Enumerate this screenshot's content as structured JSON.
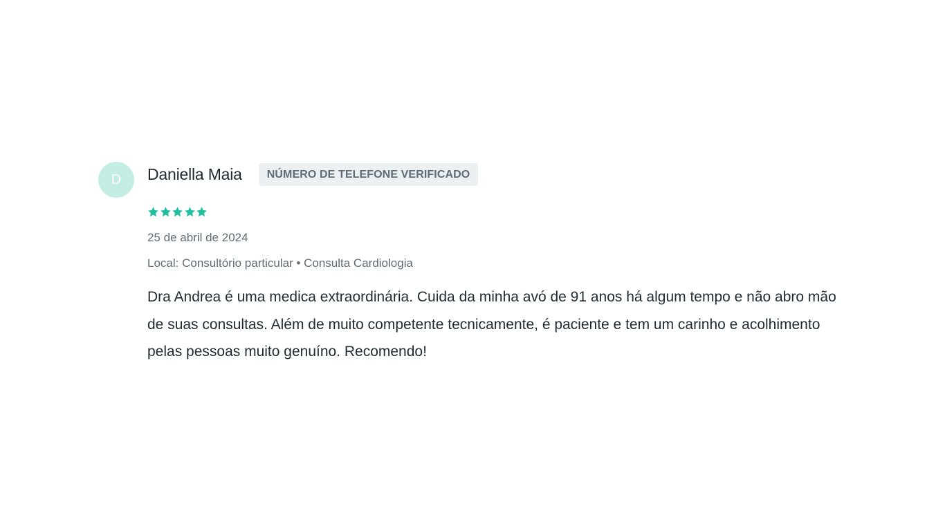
{
  "review": {
    "avatar_letter": "D",
    "author_name": "Daniella Maia",
    "badge": "NÚMERO DE TELEFONE VERIFICADO",
    "rating": 5,
    "rating_max": 5,
    "date": "25 de abril de 2024",
    "location": "Local: Consultório particular • Consulta Cardiologia",
    "text": "Dra Andrea é uma medica extraordinária. Cuida da minha avó de 91 anos há algum tempo e não abro mão de suas consultas. Além de muito competente tecnicamente, é paciente e tem um carinho e acolhimento pelas pessoas muito genuíno. Recomendo!"
  },
  "colors": {
    "star": "#1fbf9f",
    "avatar_bg": "#c3ede2",
    "badge_bg": "#edf0f2",
    "badge_text": "#5e6b75",
    "meta_text": "#5e6b75",
    "body_text": "#1f2a33"
  },
  "icons": {
    "star": "star-icon"
  }
}
